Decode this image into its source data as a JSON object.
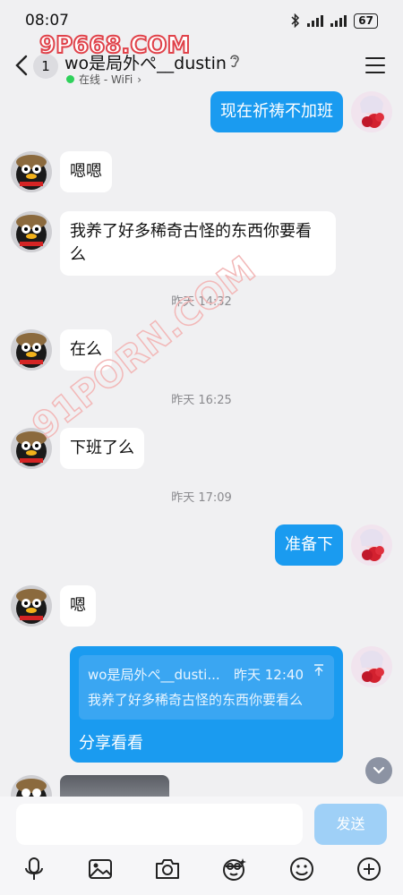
{
  "status_bar": {
    "time": "08:07",
    "battery": "67"
  },
  "header": {
    "unread_count": "1",
    "contact_name": "wo是局外ぺ__dustin",
    "status_text": "在线 - WiFi",
    "status_chevron": "›"
  },
  "watermarks": {
    "top": "9P668.COM",
    "diagonal": "91PORN.COM"
  },
  "messages": [
    {
      "side": "out",
      "text": "现在祈祷不加班"
    },
    {
      "side": "in",
      "text": "嗯嗯"
    },
    {
      "side": "in",
      "text_line1": "我养了好多稀奇古怪的东西你要看",
      "text_line2": "么"
    },
    {
      "type": "time",
      "text": "昨天 14:32"
    },
    {
      "side": "in",
      "text": "在么"
    },
    {
      "type": "time",
      "text": "昨天 16:25"
    },
    {
      "side": "in",
      "text": "下班了么"
    },
    {
      "type": "time",
      "text": "昨天 17:09"
    },
    {
      "side": "out",
      "text": "准备下"
    },
    {
      "side": "in",
      "text": "嗯"
    },
    {
      "side": "out",
      "quote_author": "wo是局外ぺ__dusti...",
      "quote_time": "昨天 12:40",
      "quote_text": "我养了好多稀奇古怪的东西你要看么",
      "text": "分享看看"
    }
  ],
  "input": {
    "placeholder": "",
    "send_label": "发送"
  },
  "toolbar_icons": [
    "mic-icon",
    "image-icon",
    "camera-icon",
    "sticker-icon",
    "emoji-icon",
    "plus-icon"
  ],
  "colors": {
    "accent": "#1a9bf0",
    "send_disabled": "#9fd0f7",
    "online": "#2fd15b",
    "background": "#f0f0f2"
  }
}
